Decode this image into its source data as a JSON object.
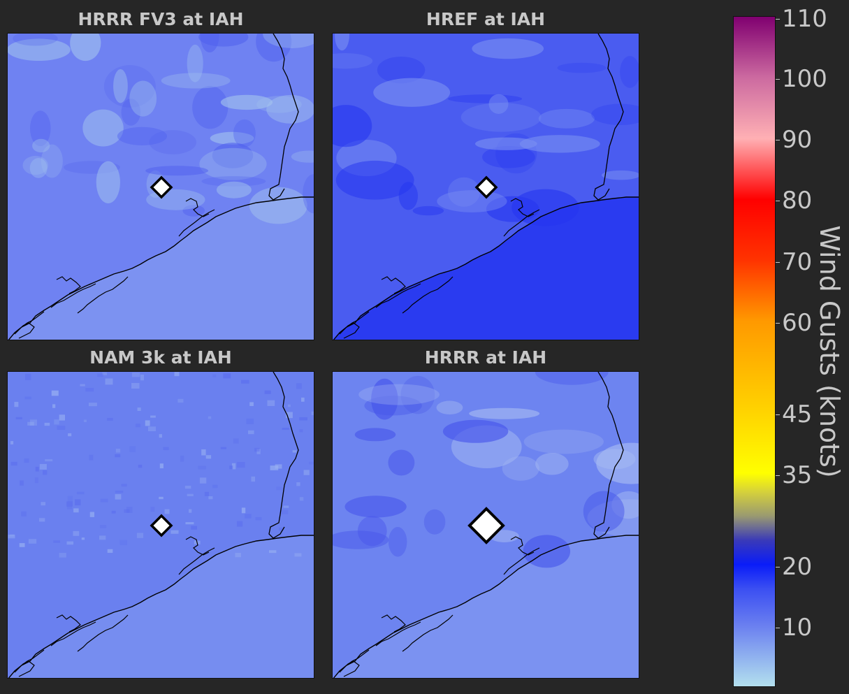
{
  "panels": [
    {
      "id": "hrrr-fv3",
      "title": "HRRR FV3 at IAH",
      "base_color": "#6f82f2",
      "light_color": "#a3c3ee",
      "dark_color": "#5060ee",
      "style": "patchy"
    },
    {
      "id": "href",
      "title": "HREF at IAH",
      "base_color": "#4a5cf0",
      "light_color": "#7b90f2",
      "dark_color": "#2535f0",
      "style": "dark"
    },
    {
      "id": "nam-3k",
      "title": "NAM 3k at IAH",
      "base_color": "#6a80ef",
      "light_color": "#9cb4f2",
      "dark_color": "#5a6cee",
      "style": "speckle"
    },
    {
      "id": "hrrr",
      "title": "HRRR at IAH",
      "base_color": "#6d84f0",
      "light_color": "#a8bcf2",
      "dark_color": "#4655ea",
      "style": "smooth"
    }
  ],
  "station": {
    "name": "IAH"
  },
  "colorbar": {
    "label": "Wind Gusts (knots)",
    "min": 0,
    "max": 110,
    "ticks": [
      "110",
      "100",
      "90",
      "80",
      "70",
      "60",
      "45",
      "35",
      "20",
      "10"
    ],
    "gradient_stops": [
      {
        "value": 0,
        "color": "#b3e0ee"
      },
      {
        "value": 10,
        "color": "#6a7ff0"
      },
      {
        "value": 16,
        "color": "#3b4ff2"
      },
      {
        "value": 20,
        "color": "#0a1cf8"
      },
      {
        "value": 24,
        "color": "#3a3ab8"
      },
      {
        "value": 28,
        "color": "#9a9a70"
      },
      {
        "value": 32,
        "color": "#d6d23a"
      },
      {
        "value": 35,
        "color": "#ffff00"
      },
      {
        "value": 45,
        "color": "#ffd400"
      },
      {
        "value": 60,
        "color": "#ff9900"
      },
      {
        "value": 70,
        "color": "#ff3300"
      },
      {
        "value": 80,
        "color": "#ff0000"
      },
      {
        "value": 90,
        "color": "#ffb0b4"
      },
      {
        "value": 100,
        "color": "#cc6aa0"
      },
      {
        "value": 110,
        "color": "#800070"
      }
    ]
  }
}
